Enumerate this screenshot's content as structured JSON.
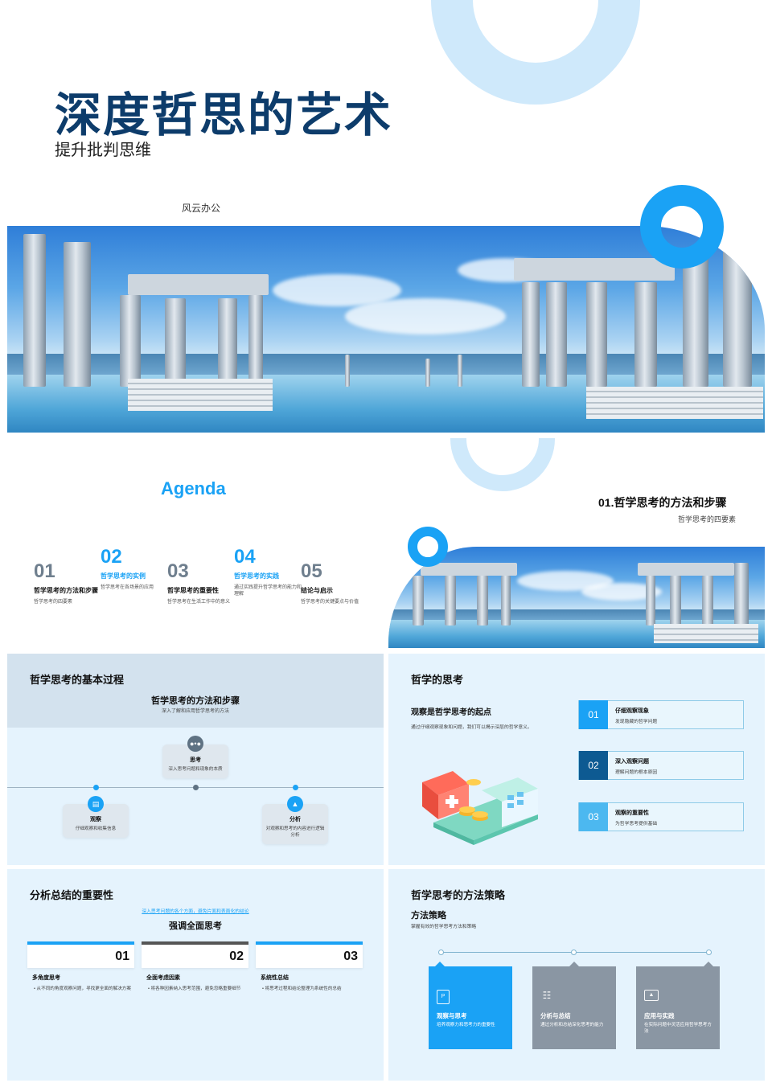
{
  "hero": {
    "title": "深度哲思的艺术",
    "subtitle": "提升批判思维",
    "brand": "风云办公"
  },
  "agenda": {
    "title": "Agenda",
    "items": [
      {
        "num": "01",
        "heading": "哲学思考的方法和步骤",
        "desc": "哲学思考的四要素"
      },
      {
        "num": "02",
        "heading": "哲学思考的实例",
        "desc": "哲学思考在各场景的应用"
      },
      {
        "num": "03",
        "heading": "哲学思考的重要性",
        "desc": "哲学思考在生活工作中的意义"
      },
      {
        "num": "04",
        "heading": "哲学思考的实践",
        "desc": "通过实践提升哲学思考的能力和理解"
      },
      {
        "num": "05",
        "heading": "结论与启示",
        "desc": "哲学思考的关键要点与价值"
      }
    ],
    "section_title": "01.哲学思考的方法和步骤",
    "section_subtitle": "哲学思考的四要素"
  },
  "process": {
    "title": "哲学思考的基本过程",
    "center_title": "哲学思考的方法和步骤",
    "center_subtitle": "深入了解和应用哲学思考的方法",
    "steps": [
      {
        "heading": "观察",
        "desc": "仔细观察和收集信息"
      },
      {
        "heading": "思考",
        "desc": "深入思考问题和现象的本质"
      },
      {
        "heading": "分析",
        "desc": "对观察和思考的内容进行逻辑分析"
      }
    ],
    "icons": [
      "document-icon",
      "chat-icon",
      "image-icon"
    ]
  },
  "thinking": {
    "title": "哲学的思考",
    "heading": "观察是哲学思考的起点",
    "desc": "通过仔细观察现象和问题，我们可以揭示深层的哲学意义。",
    "rows": [
      {
        "num": "01",
        "heading": "仔细观察现象",
        "desc": "发现隐藏的哲学问题"
      },
      {
        "num": "02",
        "heading": "深入观察问题",
        "desc": "理解问题的根本原因"
      },
      {
        "num": "03",
        "heading": "观察的重要性",
        "desc": "为哲学思考提供基础"
      }
    ],
    "colors": {
      "row1": "#1aa2f5",
      "row2": "#0d5a92",
      "row3": "#4cb8f0"
    }
  },
  "summary": {
    "title": "分析总结的重要性",
    "link": "深入思考问题的各个方面，避免片面和表面化的结论",
    "heading": "强调全面思考",
    "cards": [
      {
        "num": "01",
        "heading": "多角度思考",
        "desc": "从不同的角度观察问题，寻找更全面的解决方案"
      },
      {
        "num": "02",
        "heading": "全面考虑因素",
        "desc": "将各种因素纳入思考范围，避免忽略重要细节"
      },
      {
        "num": "03",
        "heading": "系统性总结",
        "desc": "将思考过程和结论整理为系统性的总结"
      }
    ]
  },
  "strategy": {
    "title": "哲学思考的方法策略",
    "heading": "方法策略",
    "desc": "掌握有效的哲学思考方法和策略",
    "cards": [
      {
        "heading": "观察与思考",
        "desc": "培养观察力和思考力的重要性",
        "icon": "document-icon"
      },
      {
        "heading": "分析与总结",
        "desc": "通过分析和总结深化思考的能力",
        "icon": "flowchart-icon"
      },
      {
        "heading": "应用与实践",
        "desc": "在实际问题中灵活应用哲学思考方法",
        "icon": "image-icon"
      }
    ],
    "colors": {
      "card1": "#1aa2f5",
      "card2": "#8a96a3",
      "card3": "#8a96a3"
    }
  }
}
